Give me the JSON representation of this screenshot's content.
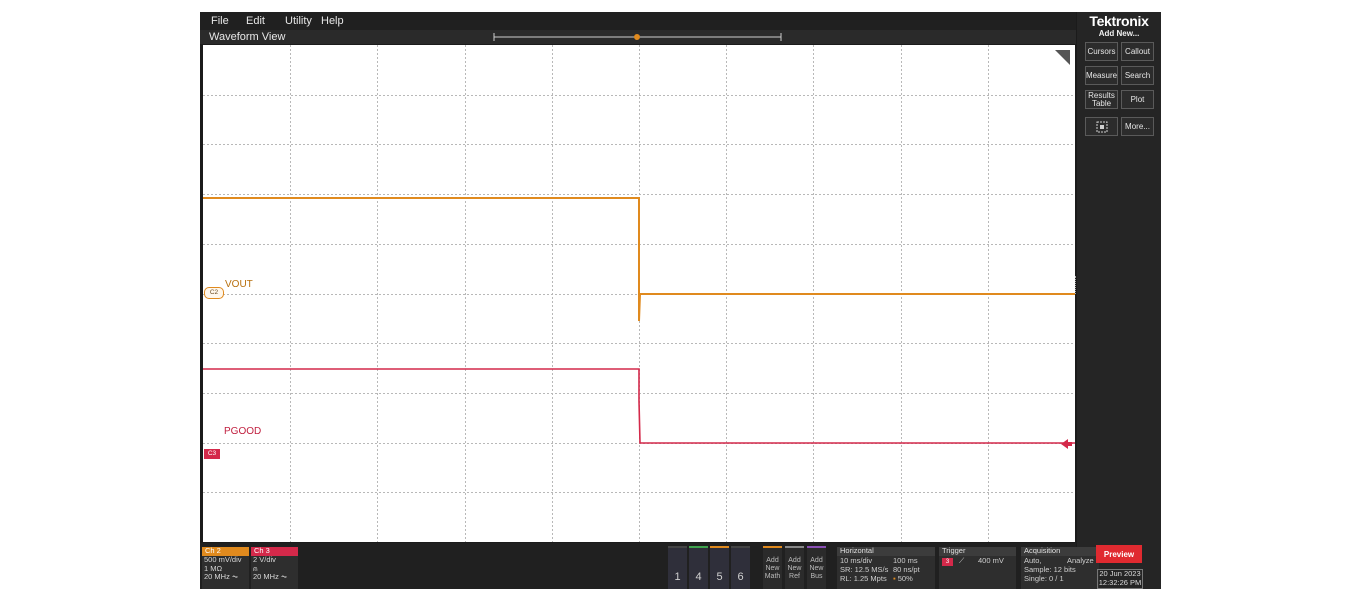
{
  "menu": {
    "file": "File",
    "edit": "Edit",
    "utility": "Utility",
    "help": "Help"
  },
  "view": {
    "title": "Waveform View"
  },
  "brand": {
    "name": "Tektronix",
    "add_new": "Add New..."
  },
  "side_buttons": {
    "cursors": "Cursors",
    "callout": "Callout",
    "measure": "Measure",
    "search": "Search",
    "results_line1": "Results",
    "results_line2": "Table",
    "plot": "Plot",
    "more": "More..."
  },
  "trigger_marker": "T",
  "channels": {
    "ch2": {
      "header": "Ch 2",
      "label": "VOUT",
      "badge": "C2",
      "scale": "500 mV/div",
      "coupling": "1 MΩ",
      "bandwidth": "20 MHz",
      "color": "#e08a1e"
    },
    "ch3": {
      "header": "Ch 3",
      "label": "PGOOD",
      "badge": "C3",
      "scale": "2 V/div",
      "coupling": "⍝",
      "bandwidth": "20 MHz",
      "color": "#d4294a"
    }
  },
  "num_buttons": [
    "1",
    "4",
    "5",
    "6"
  ],
  "add_buttons": {
    "math": {
      "l1": "Add",
      "l2": "New",
      "l3": "Math"
    },
    "ref": {
      "l1": "Add",
      "l2": "New",
      "l3": "Ref"
    },
    "bus": {
      "l1": "Add",
      "l2": "New",
      "l3": "Bus"
    }
  },
  "horizontal": {
    "title": "Horizontal",
    "scale": "10 ms/div",
    "window": "100 ms",
    "sample_rate": "SR: 12.5 MS/s",
    "point_spacing": "80 ns/pt",
    "record_length": "RL: 1.25 Mpts",
    "position": "50%"
  },
  "trigger": {
    "title": "Trigger",
    "source": "3",
    "level": "400 mV"
  },
  "acquisition": {
    "title": "Acquisition",
    "mode": "Auto,",
    "analyze": "Analyze",
    "sample": "Sample: 12 bits",
    "single": "Single: 0 / 1"
  },
  "preview_label": "Preview",
  "datetime": {
    "date": "20 Jun 2023",
    "time": "12:32:26 PM"
  },
  "waveforms": {
    "time_range_ms": [
      -50,
      50
    ],
    "trigger_time_ms": 0,
    "vout": {
      "before": "high",
      "after": "low"
    },
    "pgood": {
      "before": "high",
      "after": "low"
    }
  }
}
